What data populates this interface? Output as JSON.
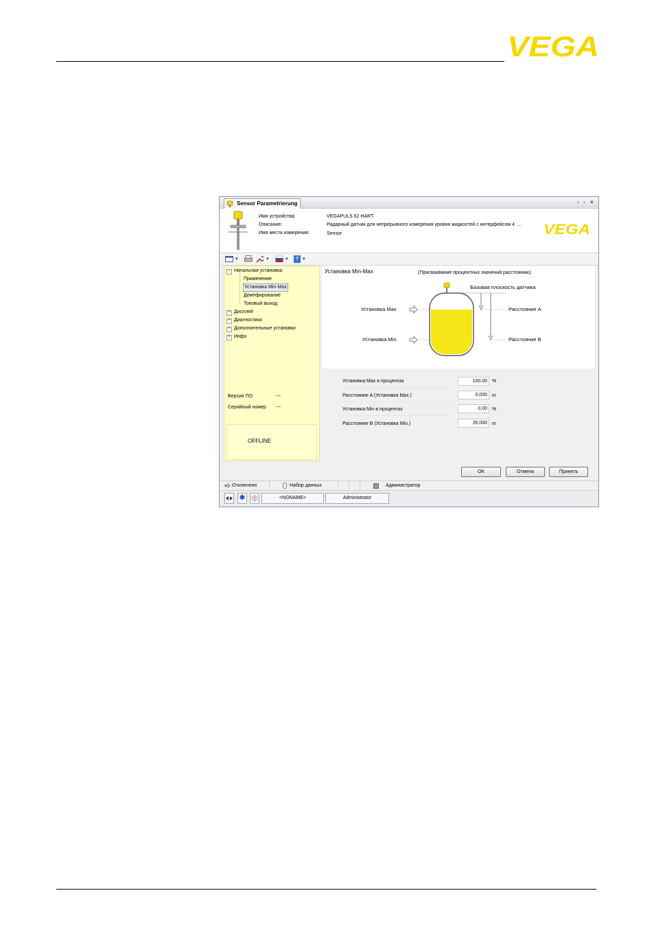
{
  "brand": {
    "logo_text": "VEGA",
    "color": "#f5d800"
  },
  "window": {
    "tab_title": "Sensor Parametrierung",
    "controls": {
      "prev": "‹",
      "next": "›",
      "close": "×"
    }
  },
  "device": {
    "name_label": "Имя устройства:",
    "name_value": "VEGAPULS 62 HART",
    "desc_label": "Описание:",
    "desc_value": "Радарный датчик для непрерывного измерения уровня жидкостей с интерфейсом 4 ....",
    "tag_label": "Имя места измерения:",
    "tag_value": "Sensor",
    "logo_text": "VEGA"
  },
  "toolbar": {
    "view_icon": "window-icon",
    "print_icon": "printer-icon",
    "tools_icon": "wrench-icon",
    "lang_icon": "flag-icon",
    "help_icon": "help-icon",
    "dropdown_glyph": "▾",
    "help_glyph": "?"
  },
  "tree": {
    "root_label": "Начальная установка",
    "root_expander": "−",
    "children": [
      "Применение",
      "Установка Min-Max",
      "Демпфирование",
      "Токовый выход"
    ],
    "selected_index": 1,
    "collapsed_expander": "+",
    "groups": [
      "Дисплей",
      "Диагностика",
      "Дополнительные установки",
      "Инфо"
    ]
  },
  "info": {
    "firmware_label": "Версия ПО",
    "firmware_value": "---",
    "serial_label": "Серийный номер",
    "serial_value": "---",
    "offline": "OFFLINE"
  },
  "main": {
    "title": "Установка Min-Max",
    "subtitle": "(Присваивание процентных значений расстоянию)",
    "sensor_plane": "Базовая плоскость датчика",
    "max_label": "Установка Max",
    "min_label": "Установка Min",
    "dist_a": "Расстояние A",
    "dist_b": "Расстояние B",
    "liquid_color": "#f5e617"
  },
  "form": {
    "fields": [
      {
        "label": "Установка Max в процентах",
        "value": "100,00",
        "unit": "%"
      },
      {
        "label": "Расстояние A (Установка Max.)",
        "value": "0,000",
        "unit": "m"
      },
      {
        "label": "Установка Min в процентах",
        "value": "0,00",
        "unit": "%"
      },
      {
        "label": "Расстояние B (Установка Min.)",
        "value": "35,000",
        "unit": "m"
      }
    ]
  },
  "buttons": {
    "ok": "OK",
    "cancel": "Отмена",
    "apply": "Принять"
  },
  "status": {
    "connection": "Отключено",
    "dataset": "Набор данных",
    "role": "Администратор"
  },
  "bottom": {
    "star": "✱",
    "project": "<NONAME>",
    "user": "Administrator"
  }
}
